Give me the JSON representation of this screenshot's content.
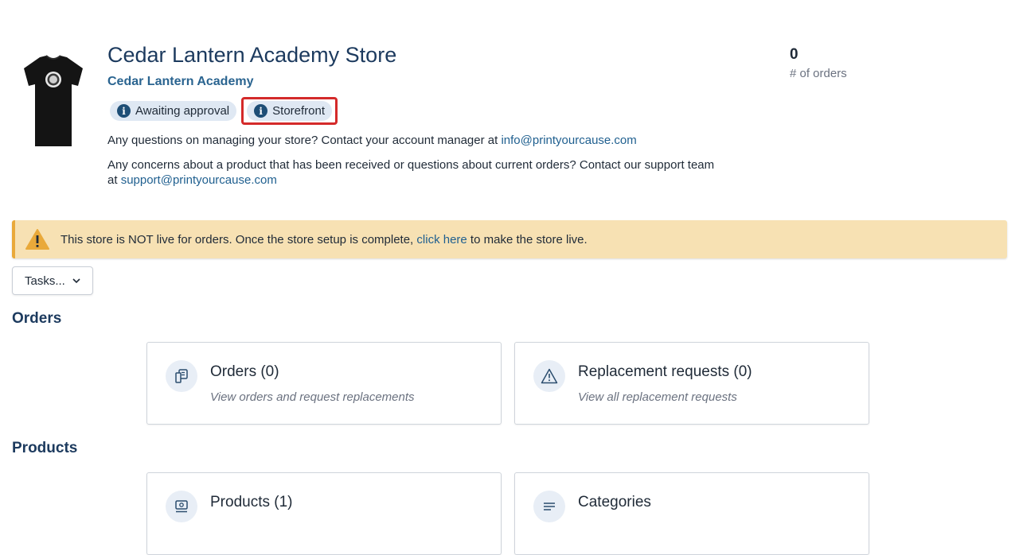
{
  "store": {
    "title": "Cedar Lantern Academy Store",
    "organization": "Cedar Lantern Academy",
    "badges": [
      {
        "label": "Awaiting approval",
        "icon": "info-icon"
      },
      {
        "label": "Storefront",
        "icon": "info-icon"
      }
    ],
    "info1_text": "Any questions on managing your store? Contact your account manager at ",
    "info1_email": "info@printyourcause.com",
    "info2_text": "Any concerns about a product that has been received or questions about current orders? Contact our support team",
    "info2_prefix": "at ",
    "info2_email": "support@printyourcause.com"
  },
  "stats": {
    "orders_count": "0",
    "orders_label": "# of orders"
  },
  "banner": {
    "icon": "warning-icon",
    "text_before": "This store is NOT live for orders. Once the store setup is complete, ",
    "link": "click here",
    "text_after": " to make the store live."
  },
  "tasks": {
    "label": "Tasks...",
    "icon": "chevron-down-icon"
  },
  "sections": {
    "orders": {
      "heading": "Orders",
      "cards": [
        {
          "title": "Orders (0)",
          "desc": "View orders and request replacements",
          "icon": "orders-icon"
        },
        {
          "title": "Replacement requests (0)",
          "desc": "View all replacement requests",
          "icon": "alert-triangle-icon"
        }
      ]
    },
    "products": {
      "heading": "Products",
      "cards": [
        {
          "title": "Products (1)",
          "icon": "products-icon"
        },
        {
          "title": "Categories",
          "icon": "list-icon"
        }
      ]
    }
  },
  "colors": {
    "accent": "#1f5f8f",
    "heading": "#1c3a5e",
    "banner_bg": "#f7e1b3",
    "highlight": "#d42a2a"
  }
}
